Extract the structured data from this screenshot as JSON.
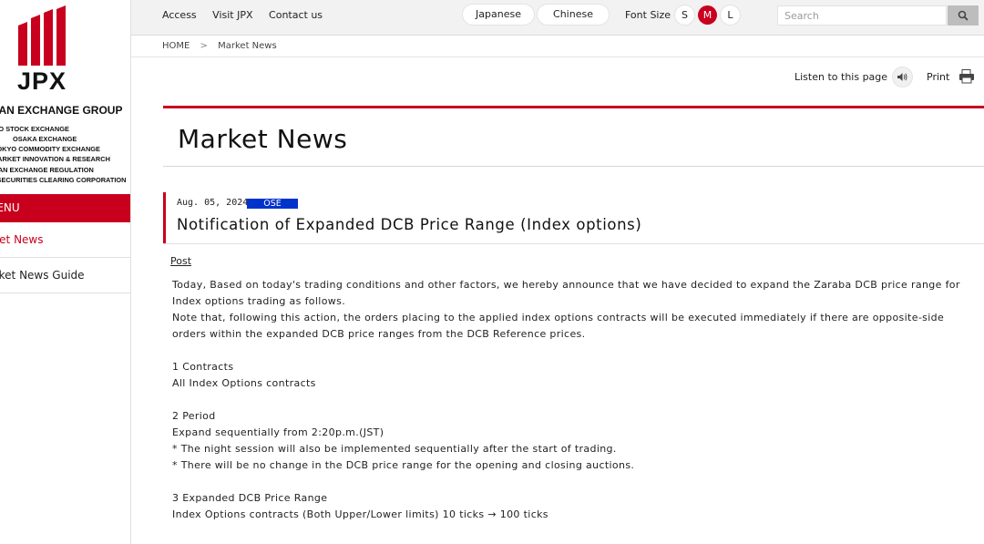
{
  "brand": {
    "name": "JPX",
    "group_name": "JAPAN EXCHANGE GROUP",
    "group_companies": [
      "TOKYO STOCK EXCHANGE",
      "OSAKA EXCHANGE",
      "TOKYO COMMODITY EXCHANGE",
      "JPX MARKET INNOVATION & RESEARCH",
      "JAPAN EXCHANGE REGULATION",
      "JAPAN SECURITIES CLEARING CORPORATION"
    ],
    "color": "#c8001e"
  },
  "sidebar": {
    "menu_label": "MENU",
    "items": [
      {
        "label": "Market News",
        "active": true
      },
      {
        "label": "Market News Guide",
        "active": false
      }
    ]
  },
  "topbar": {
    "links": [
      "Access",
      "Visit JPX",
      "Contact us"
    ],
    "languages": [
      "Japanese",
      "Chinese"
    ],
    "font_size_label": "Font Size",
    "font_sizes": [
      "S",
      "M",
      "L"
    ],
    "font_size_selected": "M",
    "search_placeholder": "Search",
    "search_icon": "search-icon"
  },
  "breadcrumb": {
    "home": "HOME",
    "separator": ">",
    "current": "Market News"
  },
  "utility": {
    "listen_label": "Listen to this page",
    "listen_icon": "speaker-icon",
    "print_label": "Print",
    "print_icon": "printer-icon"
  },
  "page": {
    "title": "Market News"
  },
  "article": {
    "date": "Aug. 05, 2024",
    "tag": "OSE",
    "tag_color": "#0033cc",
    "title": "Notification of Expanded DCB Price Range (Index options)",
    "post_label": "Post",
    "intro": "Today, Based on today's trading conditions and other factors, we hereby announce that we have decided to expand the Zaraba DCB price range for Index options trading as follows.",
    "note": "Note that, following this action, the orders placing to the applied index options contracts will be executed immediately if there are opposite-side orders within the expanded DCB price ranges from the DCB Reference prices.",
    "sections": [
      {
        "heading": "1 Contracts",
        "lines": [
          "All Index Options contracts"
        ]
      },
      {
        "heading": "2 Period",
        "lines": [
          "Expand sequentially from 2:20p.m.(JST)",
          "* The night session will also be implemented sequentially after the start of trading.",
          "* There will be no change in the DCB price range for the opening and closing auctions."
        ]
      },
      {
        "heading": "3 Expanded DCB Price Range",
        "lines": [
          "Index Options contracts (Both Upper/Lower limits)  10 ticks → 100 ticks"
        ]
      }
    ]
  }
}
